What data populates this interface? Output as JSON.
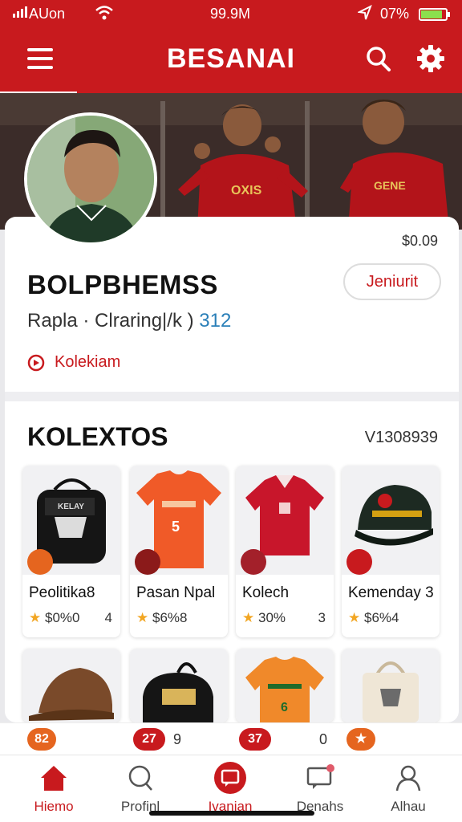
{
  "status_bar": {
    "carrier": "AUon",
    "time": "99.9M",
    "battery": "07%",
    "battery_level": 0.8
  },
  "header": {
    "title": "BESANAI"
  },
  "profile": {
    "price": "$0.09",
    "name": "BOLPBHEMSS",
    "follow_label": "Jeniurit",
    "meta_text": "Rapla · Clraring|/k ) ",
    "meta_number": "312",
    "location": "Kolekiam"
  },
  "collection": {
    "title": "KOLEXTOS",
    "count": "V1308939",
    "items": [
      {
        "name": "Peolitika8",
        "price": "$0%0",
        "qty": "4",
        "badge_icon": "flag-icon"
      },
      {
        "name": "Pasan Npal",
        "price": "$6%8",
        "qty": "",
        "badge_icon": "crest-icon"
      },
      {
        "name": "Kolech",
        "price": "30%",
        "qty": "3",
        "badge_icon": "crest-icon"
      },
      {
        "name": "Kemenday 3",
        "price": "$6%4",
        "qty": "",
        "badge_icon": "star-icon"
      }
    ],
    "items_row2": [
      {
        "icon": "cap-icon"
      },
      {
        "icon": "bag-icon"
      },
      {
        "icon": "jersey-icon"
      },
      {
        "icon": "tote-icon"
      }
    ]
  },
  "strip": {
    "badge1": "82",
    "badge2": "27",
    "text2": "9",
    "badge3": "37",
    "text3": "0"
  },
  "nav": {
    "tabs": [
      {
        "label": "Hiemo"
      },
      {
        "label": "Profinl"
      },
      {
        "label": "Ivanjan"
      },
      {
        "label": "Denahs"
      },
      {
        "label": "Alhau"
      }
    ]
  },
  "colors": {
    "brand": "#c81a1e",
    "accent": "#e5651f",
    "star": "#f2a623",
    "link": "#2a7fb8"
  }
}
